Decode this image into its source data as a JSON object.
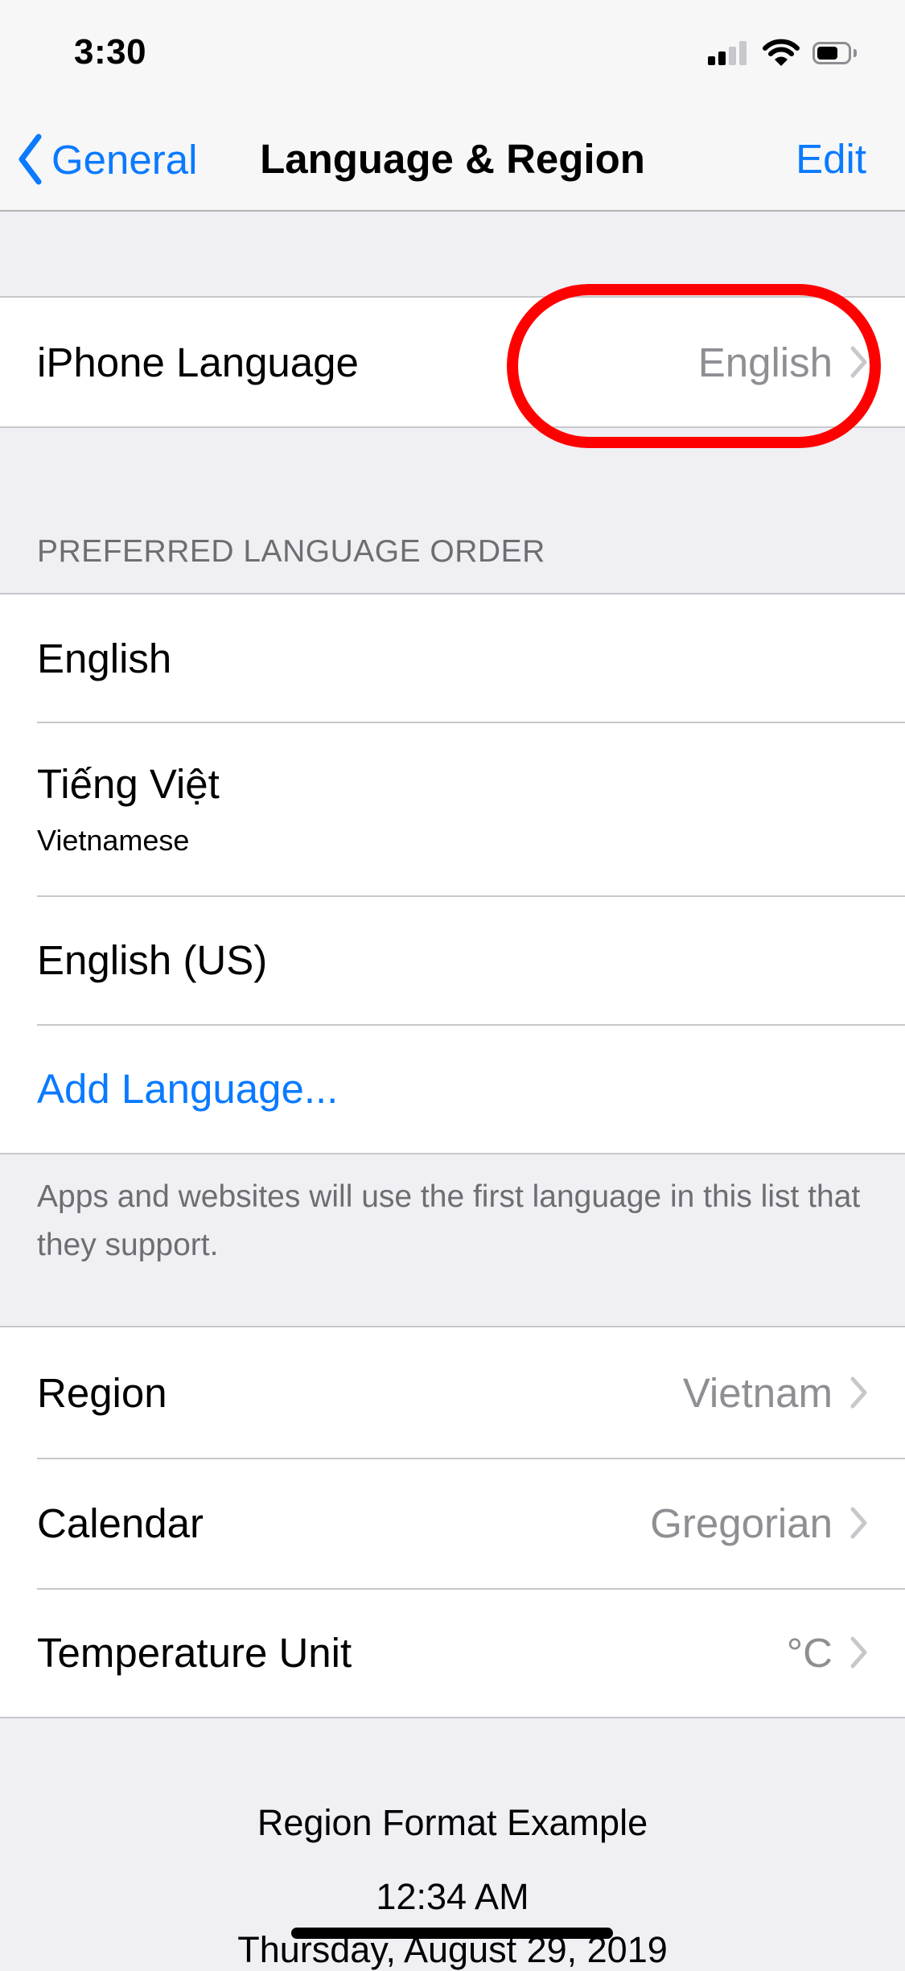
{
  "status_bar": {
    "time": "3:30",
    "signal_bars_filled": 2,
    "signal_bars_total": 4,
    "wifi_icon": "wifi-icon",
    "battery_level_percent": 70
  },
  "nav": {
    "back_label": "General",
    "title": "Language & Region",
    "edit_label": "Edit"
  },
  "iphone_language": {
    "label": "iPhone Language",
    "value": "English"
  },
  "preferred_languages": {
    "header": "PREFERRED LANGUAGE ORDER",
    "items": [
      {
        "label": "English",
        "sublabel": null
      },
      {
        "label": "Tiếng Việt",
        "sublabel": "Vietnamese"
      },
      {
        "label": "English (US)",
        "sublabel": null
      }
    ],
    "add_label": "Add Language...",
    "footer": "Apps and websites will use the first language in this list that they support."
  },
  "region_settings": [
    {
      "label": "Region",
      "value": "Vietnam"
    },
    {
      "label": "Calendar",
      "value": "Gregorian"
    },
    {
      "label": "Temperature Unit",
      "value": "°C"
    }
  ],
  "region_format_example": {
    "title": "Region Format Example",
    "time": "12:34 AM",
    "date": "Thursday, August 29, 2019"
  },
  "colors": {
    "accent": "#0a7aff",
    "annotation": "#ff0000",
    "secondary_text": "#8e8e93",
    "grouped_background": "#efeff4"
  }
}
